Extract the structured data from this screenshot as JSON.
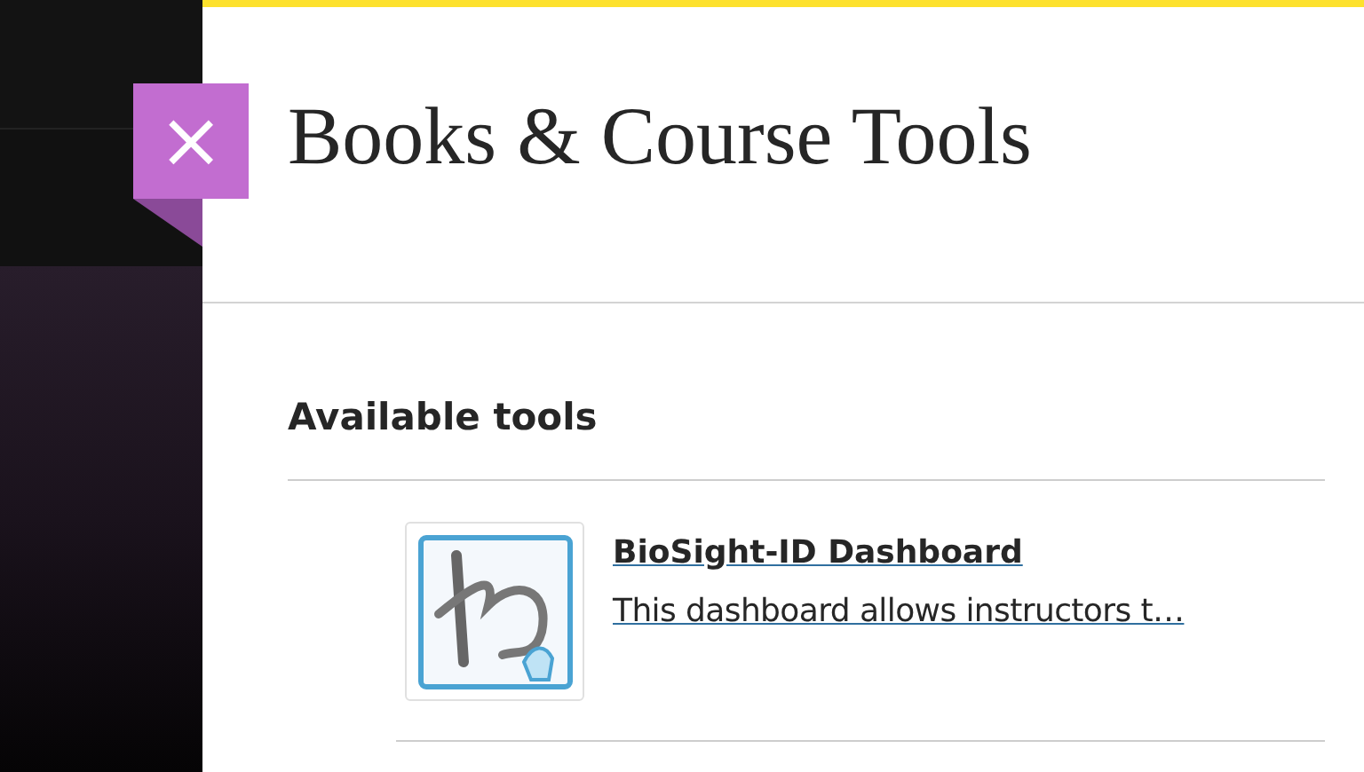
{
  "close_button": {
    "label": "×"
  },
  "title": "Books & Course Tools",
  "section": {
    "heading": "Available tools",
    "tools": [
      {
        "name": "BioSight-ID Dashboard",
        "description": "This dashboard allows instructors t…"
      }
    ]
  }
}
